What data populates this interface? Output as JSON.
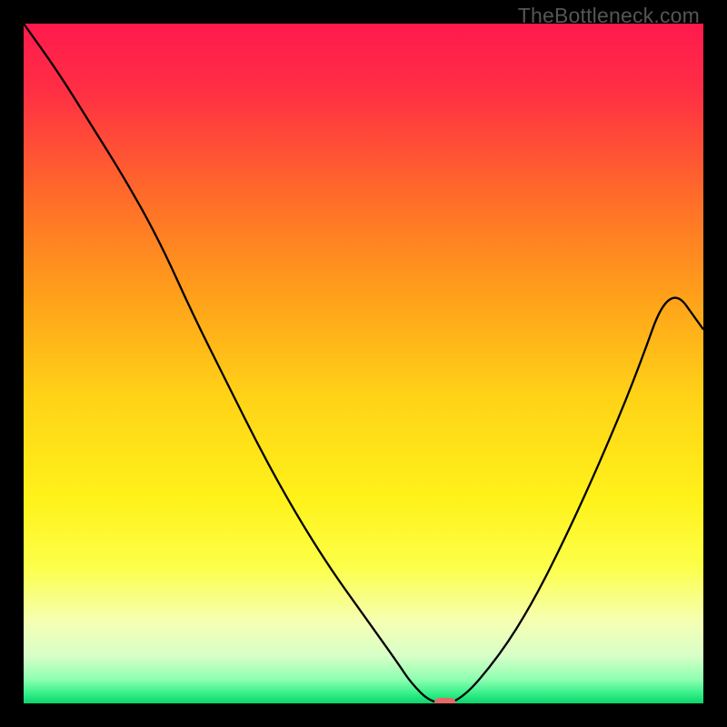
{
  "watermark": "TheBottleneck.com",
  "chart_data": {
    "type": "line",
    "title": "",
    "xlabel": "",
    "ylabel": "",
    "xlim": [
      0,
      100
    ],
    "ylim": [
      0,
      100
    ],
    "grid": false,
    "background_gradient_stops": [
      {
        "offset": 0.0,
        "color": "#ff1a4d"
      },
      {
        "offset": 0.1,
        "color": "#ff2f44"
      },
      {
        "offset": 0.25,
        "color": "#ff6a2a"
      },
      {
        "offset": 0.4,
        "color": "#ffa01a"
      },
      {
        "offset": 0.55,
        "color": "#ffd317"
      },
      {
        "offset": 0.7,
        "color": "#fff21a"
      },
      {
        "offset": 0.8,
        "color": "#fcff4a"
      },
      {
        "offset": 0.88,
        "color": "#f5ffb3"
      },
      {
        "offset": 0.93,
        "color": "#d8ffc8"
      },
      {
        "offset": 0.965,
        "color": "#8dffb0"
      },
      {
        "offset": 0.985,
        "color": "#37f08a"
      },
      {
        "offset": 1.0,
        "color": "#0bd46a"
      }
    ],
    "series": [
      {
        "name": "bottleneck-curve",
        "color": "#000000",
        "width": 2.3,
        "x": [
          0,
          5,
          10,
          15,
          20,
          25,
          30,
          35,
          40,
          45,
          50,
          55,
          57,
          60,
          64,
          70,
          75,
          80,
          85,
          90,
          95,
          100
        ],
        "y": [
          100,
          93,
          85,
          77,
          68,
          57,
          47,
          37,
          28,
          20,
          13,
          6,
          3,
          0,
          0,
          7,
          15,
          25,
          36,
          48,
          62,
          55
        ]
      }
    ],
    "marker": {
      "name": "optimal-point-marker",
      "x": 62,
      "y": 0,
      "width": 3.2,
      "height": 1.6,
      "color": "#e46a6a",
      "rx": 6
    }
  }
}
